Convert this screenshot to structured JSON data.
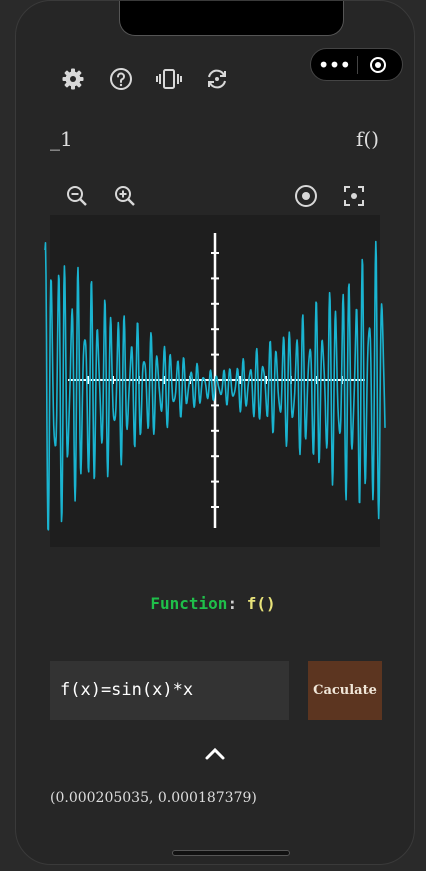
{
  "toolbar": {
    "icons": [
      "gear-icon",
      "help-icon",
      "vibrate-icon",
      "refresh-icon"
    ]
  },
  "capsule": {
    "more_icon": "more-icon",
    "close_icon": "target-icon"
  },
  "header": {
    "left_label": "_1",
    "right_label": "f()"
  },
  "graph_controls": {
    "icons": [
      "zoom-out-icon",
      "zoom-in-icon",
      "center-icon",
      "fit-icon"
    ]
  },
  "function_line": {
    "keyword": "Function",
    "colon": ": ",
    "value": "f()"
  },
  "input": {
    "value": "f(x)=sin(x)*x"
  },
  "calculate_button": {
    "label": "Caculate"
  },
  "coords": {
    "text": "(0.000205035, 0.000187379)"
  },
  "colors": {
    "curve": "#1ab4d0",
    "axis": "#ffffff",
    "button": "#5c3520"
  },
  "chart_data": {
    "type": "line",
    "series": [
      {
        "expression": "f(x)=sin(x)*x"
      }
    ],
    "title": "",
    "xlabel": "",
    "ylabel": ""
  }
}
